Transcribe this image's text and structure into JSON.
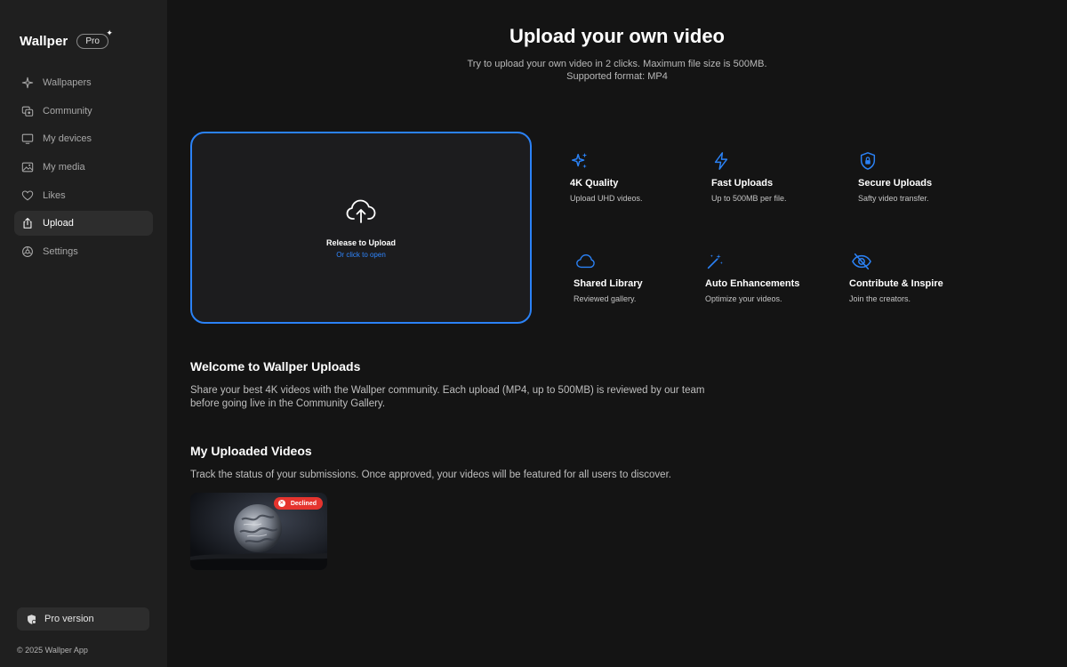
{
  "sidebar": {
    "brand": "Wallper",
    "pro_badge": "Pro",
    "items": [
      {
        "label": "Wallpapers",
        "icon": "sparkle-icon"
      },
      {
        "label": "Community",
        "icon": "community-icon"
      },
      {
        "label": "My devices",
        "icon": "monitor-icon"
      },
      {
        "label": "My media",
        "icon": "photo-icon"
      },
      {
        "label": "Likes",
        "icon": "heart-icon"
      },
      {
        "label": "Upload",
        "icon": "upload-icon",
        "active": true
      },
      {
        "label": "Settings",
        "icon": "settings-icon"
      }
    ],
    "pro_version": "Pro version",
    "copyright": "© 2025 Wallper App"
  },
  "header": {
    "title": "Upload your own video",
    "subtitle_line1": "Try to upload your own video in 2 clicks. Maximum file size is 500MB.",
    "subtitle_line2": "Supported format: MP4"
  },
  "dropzone": {
    "primary": "Release to Upload",
    "secondary": "Or click to open"
  },
  "features": [
    {
      "title": "4K Quality",
      "desc": "Upload UHD videos.",
      "icon": "sparkles-icon"
    },
    {
      "title": "Fast Uploads",
      "desc": "Up to 500MB per file.",
      "icon": "bolt-icon"
    },
    {
      "title": "Secure Uploads",
      "desc": "Safty video transfer.",
      "icon": "shield-lock-icon"
    },
    {
      "title": "Shared Library",
      "desc": "Reviewed gallery.",
      "icon": "cloud-icon"
    },
    {
      "title": "Auto Enhancements",
      "desc": "Optimize your videos.",
      "icon": "magic-wand-icon"
    },
    {
      "title": "Contribute & Inspire",
      "desc": "Join the creators.",
      "icon": "eye-slash-icon"
    }
  ],
  "welcome": {
    "title": "Welcome to Wallper Uploads",
    "text": "Share your best 4K videos with the Wallper community. Each upload (MP4, up to 500MB) is reviewed by our team before going live in the Community Gallery."
  },
  "uploads": {
    "title": "My Uploaded Videos",
    "text": "Track the status of your submissions. Once approved, your videos will be featured for all users to discover.",
    "videos": [
      {
        "status": "Declined",
        "status_color": "#e5342e"
      }
    ]
  },
  "colors": {
    "accent": "#2b82f6",
    "sidebar_bg": "#1f1f1f",
    "main_bg": "#141414",
    "declined": "#e5342e"
  }
}
